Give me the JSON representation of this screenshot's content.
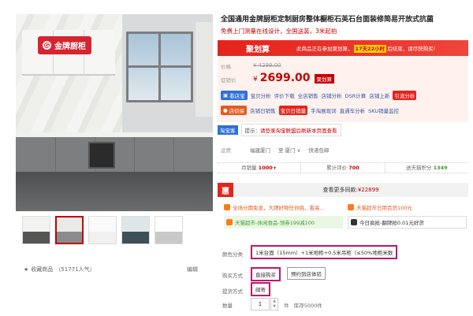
{
  "gallery": {
    "logo_mark": "G",
    "logo_text": "金牌厨柜",
    "thumbnail_count": 5,
    "collect_label": "收藏商品",
    "collect_count": "（51771人气）",
    "edit_label": "编辑"
  },
  "product": {
    "title": "全国通用金牌厨柜定制厨房整体橱柜石英石台面装修简易开放式抗菌",
    "subtitle": "免费上门测量在线设计，全国送装，3米起拍"
  },
  "jhs_banner": {
    "logo": "聚划算",
    "text_before": "此商品正在参加聚划算，",
    "highlight": "17天22小时",
    "text_after": "后结束，请尽快购买!"
  },
  "price": {
    "original_label": "价格",
    "original_value": "¥ 4299.00",
    "promo_label": "促销价",
    "currency": "¥",
    "promo_value": "2699.00",
    "promo_tag": "聚划算"
  },
  "tool_rows": [
    {
      "badge": "看店宝",
      "items": [
        "宝贝分析",
        "评价下载",
        "全店销售",
        "店铺分析",
        "DSR计算",
        "店铺上新"
      ],
      "chip": "引流分析"
    },
    {
      "badge": "店侦探",
      "items": [
        "店铺日销售"
      ],
      "chip": "宝贝日销量",
      "items_after": [
        "手淘展现词",
        "直通车分析",
        "SKU销量监控"
      ]
    }
  ],
  "taobaoke": {
    "badge": "淘宝客",
    "hint_prefix": "提示：",
    "hint_link": "请登录淘宝联盟后刷新本页面查看"
  },
  "shipping": {
    "label": "运费",
    "from": "福建厦门",
    "to": "至 厦门",
    "free": "快递包邮"
  },
  "stats": {
    "monthly_label": "月销量",
    "monthly_value": "1000+",
    "reviews_label": "累计评价",
    "reviews_value": "700",
    "points_label": "送天猫积分",
    "points_value": "1349"
  },
  "hui": {
    "icon": "惠",
    "text": "查看更多同款:",
    "price": "¥22899"
  },
  "promotions": [
    {
      "text": "全场分期免息，大牌好物任你挑，看高...",
      "style": "orange"
    },
    {
      "text": "天猫超市日用百货100元",
      "style": "orange"
    },
    {
      "text": "天猫超市-休闲食品-领券199减100",
      "style": "green-box"
    },
    {
      "text": "今日疯抢-翻牌抢0.01元好货",
      "style": "white-box"
    }
  ],
  "options": {
    "color_label": "颜色分类",
    "color_value": "1米台面（15mm）+1米地柜+0.5米吊柜（≤50%地柜米数",
    "purchase_label": "购买方式",
    "purchase_values": [
      "直接购买",
      "预约到店体验"
    ],
    "delivery_label": "提货方式",
    "delivery_value": "邮寄",
    "qty_label": "数量",
    "qty_value": "1",
    "unit": "件",
    "stock": "库存5000件"
  },
  "colors": {
    "tmall_red": "#c40000",
    "jhs_red": "#e4231c",
    "option_selected": "#c0156b",
    "blue_badge": "#2f6fd9",
    "green_points": "#3a9b28"
  }
}
